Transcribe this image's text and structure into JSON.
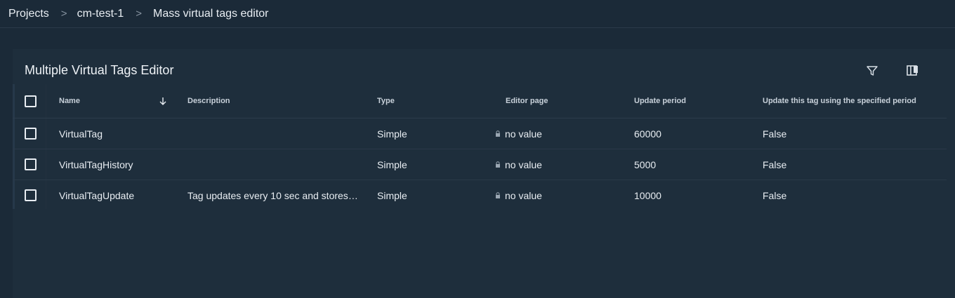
{
  "breadcrumb": {
    "items": [
      "Projects",
      "cm-test-1",
      "Mass virtual tags editor"
    ],
    "separator": ">"
  },
  "panel": {
    "title": "Multiple Virtual Tags Editor"
  },
  "table": {
    "columns": [
      "Name",
      "Description",
      "Type",
      "Editor page",
      "Update period",
      "Update this tag using the specified period"
    ],
    "sort": {
      "column": "Name",
      "direction": "descending"
    },
    "rows": [
      {
        "name": "VirtualTag",
        "description": "",
        "type": "Simple",
        "editor_page": "no value",
        "update_period": "60000",
        "update_flag": "False"
      },
      {
        "name": "VirtualTagHistory",
        "description": "",
        "type": "Simple",
        "editor_page": "no value",
        "update_period": "5000",
        "update_flag": "False"
      },
      {
        "name": "VirtualTagUpdate",
        "description": "Tag updates every 10 sec and stores a...",
        "type": "Simple",
        "editor_page": "no value",
        "update_period": "10000",
        "update_flag": "False"
      }
    ]
  },
  "icons": {
    "filter": "filter-icon",
    "columns": "column-chooser-icon",
    "sort": "arrow-down-icon",
    "lock": "lock-icon"
  },
  "colors": {
    "background": "#1b2a38",
    "panel": "#1e2e3c",
    "text": "#e8edf2"
  }
}
